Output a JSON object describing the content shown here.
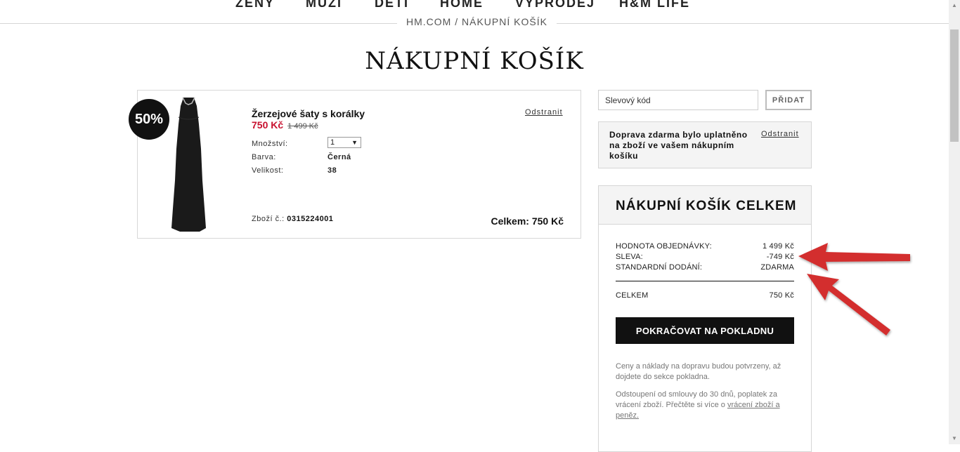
{
  "nav": {
    "items": [
      "ŽENY",
      "MUŽI",
      "DĚTI",
      "HOME",
      "VÝPRODEJ",
      "H&M LIFE"
    ]
  },
  "breadcrumb": {
    "site": "HM.COM",
    "separator": " / ",
    "current": "NÁKUPNÍ KOŠÍK"
  },
  "page_title": "NÁKUPNÍ KOŠÍK",
  "cart_item": {
    "discount_badge": "50%",
    "name": "Žerzejové šaty s korálky",
    "price_new": "750 Kč",
    "price_old": "1 499 Kč",
    "quantity_label": "Množství:",
    "quantity_value": "1",
    "color_label": "Barva:",
    "color_value": "Černá",
    "size_label": "Velikost:",
    "size_value": "38",
    "remove_label": "Odstranit",
    "sku_label": "Zboží č.:",
    "sku_value": "0315224001",
    "total_label": "Celkem: 750 Kč"
  },
  "promo": {
    "placeholder": "Slevový kód",
    "button_label": "PŘIDAT"
  },
  "shipping_notice": {
    "text": "Doprava zdarma bylo uplatněno na zboží ve vašem nákupním košíku",
    "remove_label": "Odstranit"
  },
  "summary": {
    "title": "NÁKUPNÍ KOŠÍK CELKEM",
    "rows": [
      {
        "label": "HODNOTA OBJEDNÁVKY:",
        "value": "1 499 Kč"
      },
      {
        "label": "SLEVA:",
        "value": "-749 Kč"
      },
      {
        "label": "STANDARDNÍ DODÁNÍ:",
        "value": "ZDARMA"
      }
    ],
    "total_label": "CELKEM",
    "total_value": "750 Kč",
    "checkout_label": "POKRAČOVAT NA POKLADNU",
    "note1": "Ceny a náklady na dopravu budou potvrzeny, až dojdete do sekce pokladna.",
    "note2_text": "Odstoupení od smlouvy do 30 dnů, poplatek za vrácení zboží. Přečtěte si více o ",
    "note2_link": "vrácení zboží a peněz."
  },
  "colors": {
    "price_red": "#c8102e",
    "annotation_arrow": "#d32f2f",
    "button_black": "#111111"
  }
}
